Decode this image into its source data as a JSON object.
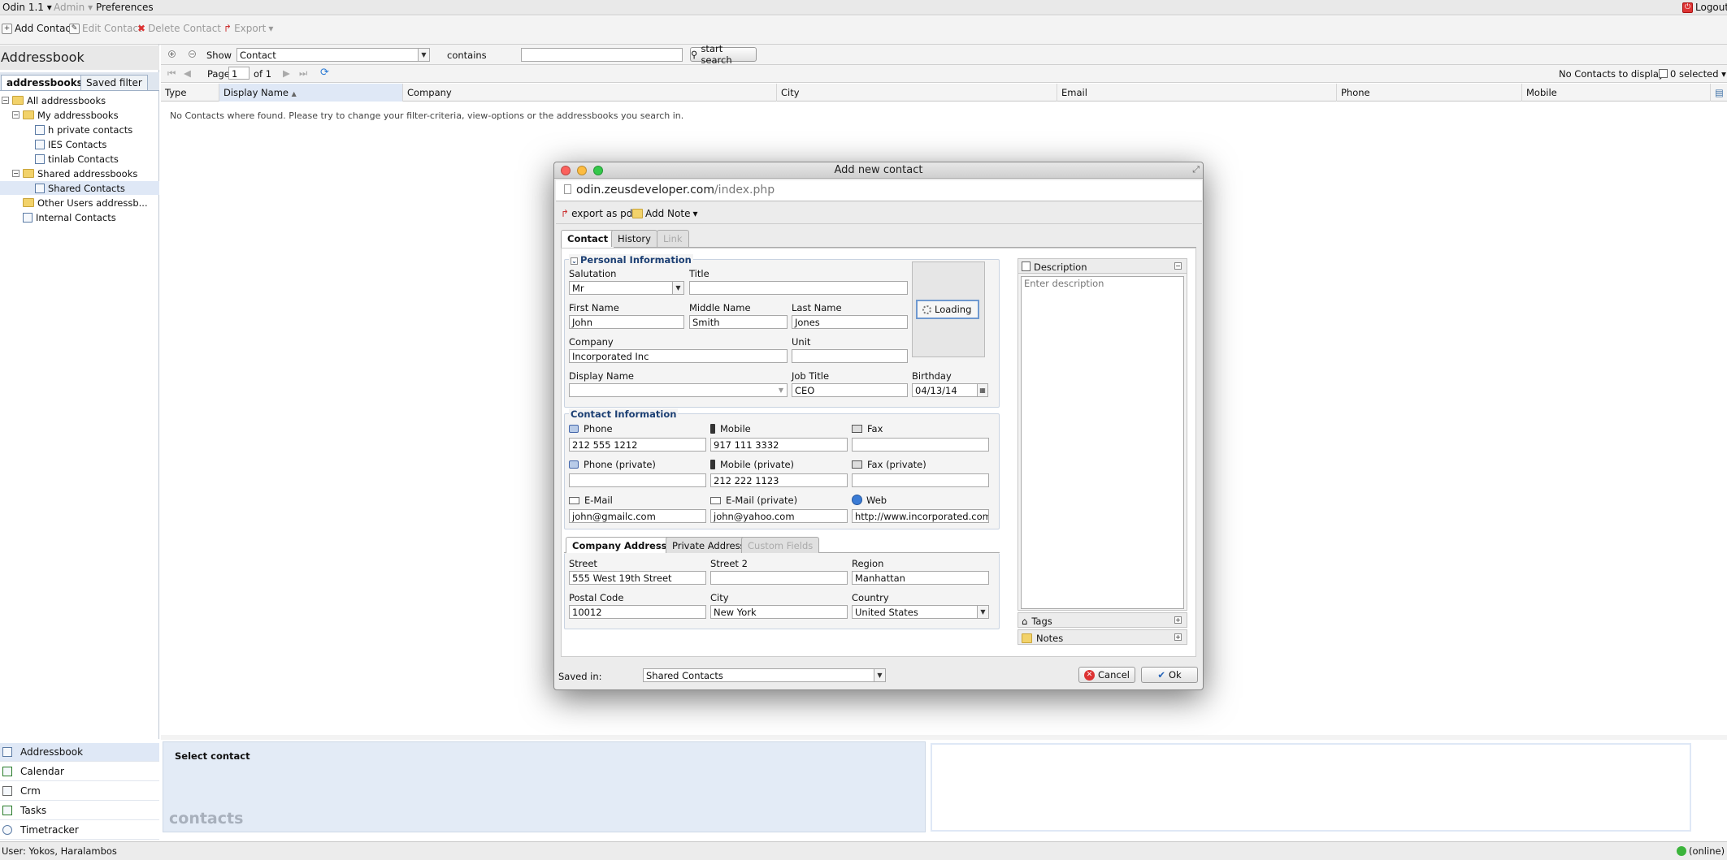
{
  "menubar": {
    "app": "Odin 1.1",
    "admin": "Admin",
    "preferences": "Preferences",
    "logout": "Logout"
  },
  "toolbar": {
    "add": "Add Contact",
    "edit": "Edit Contact",
    "delete": "Delete Contact",
    "export": "Export"
  },
  "left": {
    "title": "Addressbook",
    "tabs": [
      "addressbooks",
      "Saved filter"
    ],
    "tree": {
      "all": "All addressbooks",
      "my": "My addressbooks",
      "my_items": [
        "h private contacts",
        "IES Contacts",
        "tinlab Contacts"
      ],
      "shared": "Shared addressbooks",
      "shared_items": [
        "Shared Contacts"
      ],
      "other": "Other Users addressb...",
      "internal": "Internal Contacts"
    },
    "modules": [
      "Addressbook",
      "Calendar",
      "Crm",
      "Tasks",
      "Timetracker"
    ]
  },
  "filter": {
    "show": "Show",
    "field": "Contact",
    "operator": "contains",
    "value": "",
    "search_button": "start search"
  },
  "pager": {
    "page_label": "Page",
    "page": "1",
    "of": "of 1",
    "display_info": "No Contacts to display",
    "selected": "0 selected"
  },
  "columns": [
    "Type",
    "Display Name",
    "Company",
    "City",
    "Email",
    "Phone",
    "Mobile"
  ],
  "empty_message": "No Contacts where found. Please try to change your filter-criteria, view-options or the addressbooks you search in.",
  "bottom": {
    "select_contact": "Select contact",
    "watermark": "contacts"
  },
  "status": {
    "user": "User: Yokos, Haralambos",
    "online": "(online)"
  },
  "modal": {
    "title": "Add new contact",
    "url_host": "odin.zeusdeveloper.com",
    "url_path": "/index.php",
    "export_pdf": "export as pdf",
    "add_note": "Add Note",
    "tabs": [
      "Contact",
      "History",
      "Link"
    ],
    "personal": {
      "legend": "Personal Information",
      "salutation_label": "Salutation",
      "salutation": "Mr",
      "title_label": "Title",
      "title": "",
      "first_name_label": "First Name",
      "first_name": "John",
      "middle_name_label": "Middle Name",
      "middle_name": "Smith",
      "last_name_label": "Last Name",
      "last_name": "Jones",
      "company_label": "Company",
      "company": "Incorporated Inc",
      "unit_label": "Unit",
      "unit": "",
      "display_name_label": "Display Name",
      "display_name": "",
      "job_title_label": "Job Title",
      "job_title": "CEO",
      "birthday_label": "Birthday",
      "birthday": "04/13/14",
      "loading": "Loading"
    },
    "contact": {
      "legend": "Contact Information",
      "phone_label": "Phone",
      "phone": "212 555 1212",
      "mobile_label": "Mobile",
      "mobile": "917 111 3332",
      "fax_label": "Fax",
      "fax": "",
      "phone_private_label": "Phone (private)",
      "phone_private": "",
      "mobile_private_label": "Mobile (private)",
      "mobile_private": "212 222 1123",
      "fax_private_label": "Fax (private)",
      "fax_private": "",
      "email_label": "E-Mail",
      "email": "john@gmailc.com",
      "email_private_label": "E-Mail (private)",
      "email_private": "john@yahoo.com",
      "web_label": "Web",
      "web": "http://www.incorporated.com"
    },
    "address_tabs": [
      "Company Address",
      "Private Address",
      "Custom Fields"
    ],
    "address": {
      "street_label": "Street",
      "street": "555 West 19th Street",
      "street2_label": "Street 2",
      "street2": "",
      "region_label": "Region",
      "region": "Manhattan",
      "postal_label": "Postal Code",
      "postal": "10012",
      "city_label": "City",
      "city": "New York",
      "country_label": "Country",
      "country": "United States"
    },
    "side": {
      "description_title": "Description",
      "description_placeholder": "Enter description",
      "tags": "Tags",
      "notes": "Notes"
    },
    "footer": {
      "saved_in_label": "Saved in:",
      "saved_in": "Shared Contacts",
      "cancel": "Cancel",
      "ok": "Ok"
    }
  },
  "colors": {
    "accent": "#1c3f73",
    "selection": "#dfe8f6",
    "close": "#fc615d",
    "minimize": "#fdbc40",
    "zoom": "#34c84a"
  }
}
